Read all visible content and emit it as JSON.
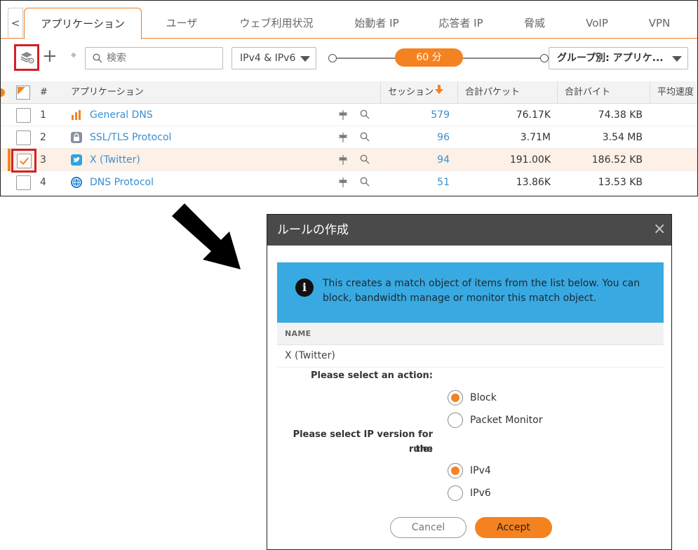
{
  "tabs": {
    "back_icon": "chevron-left-icon",
    "items": [
      "アプリケーション",
      "ユーザ",
      "ウェブ利用状況",
      "始動者 IP",
      "応答者 IP",
      "脅威",
      "VoIP",
      "VPN"
    ],
    "active_index": 0
  },
  "toolbar": {
    "layers_icon": "layers-settings-icon",
    "add_icon": "plus-icon",
    "search_placeholder": "検索",
    "ip_filter": "IPv4 & IPv6",
    "time_range": "60 分",
    "group_by": "グループ別: アプリケ..."
  },
  "table": {
    "columns": [
      "#",
      "アプリケーション",
      "セッション",
      "合計パケット",
      "合計バイト",
      "平均速度 ("
    ],
    "sort_column": "セッション",
    "sort_direction": "descending",
    "rows": [
      {
        "num": "1",
        "app": "General DNS",
        "icon": "dns-chart-icon",
        "sessions": "579",
        "packets": "76.17K",
        "bytes": "74.38 KB",
        "checked": false
      },
      {
        "num": "2",
        "app": "SSL/TLS Protocol",
        "icon": "lock-icon",
        "sessions": "96",
        "packets": "3.71M",
        "bytes": "3.54 MB",
        "checked": false
      },
      {
        "num": "3",
        "app": "X (Twitter)",
        "icon": "twitter-bird-icon",
        "sessions": "94",
        "packets": "191.00K",
        "bytes": "186.52 KB",
        "checked": true
      },
      {
        "num": "4",
        "app": "DNS Protocol",
        "icon": "globe-icon",
        "sessions": "51",
        "packets": "13.86K",
        "bytes": "13.53 KB",
        "checked": false
      }
    ]
  },
  "dialog": {
    "title": "ルールの作成",
    "close_icon": "close-icon",
    "info_text": "This creates a match object of items from the list below. You can block, bandwidth manage or monitor this match object.",
    "name_header": "NAME",
    "name_value": "X (Twitter)",
    "action_label": "Please select an action:",
    "action_options": [
      "Block",
      "Packet Monitor"
    ],
    "action_selected": "Block",
    "ip_label_line1": "Please select IP version for the",
    "ip_label_line2": "rule:",
    "ip_options": [
      "IPv4",
      "IPv6"
    ],
    "ip_selected": "IPv4",
    "cancel_label": "Cancel",
    "accept_label": "Accept"
  },
  "colors": {
    "accent": "#f58220",
    "link": "#3a8fd1",
    "highlight_box": "#d32026",
    "info_bg": "#39a9e1",
    "dialog_header": "#4a4a4a"
  }
}
